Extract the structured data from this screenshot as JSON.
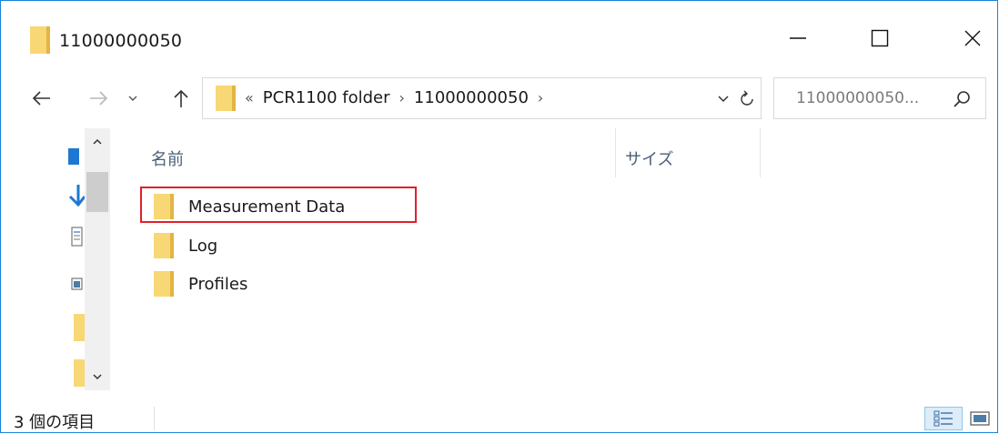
{
  "window": {
    "title": "11000000050",
    "accent": "#1883d7"
  },
  "address_bar": {
    "overflow": "«",
    "crumbs": [
      "PCR1100 folder",
      "11000000050"
    ],
    "separator": "›"
  },
  "search": {
    "placeholder": "11000000050..."
  },
  "columns": {
    "name": "名前",
    "size": "サイズ"
  },
  "files": [
    {
      "name": "Measurement Data",
      "icon": "folder-icon",
      "highlighted": true
    },
    {
      "name": "Log",
      "icon": "folder-icon",
      "highlighted": false
    },
    {
      "name": "Profiles",
      "icon": "folder-icon",
      "highlighted": false
    }
  ],
  "status": {
    "item_count": "3 個の項目"
  },
  "colors": {
    "folder": "#f8d775",
    "folder_dark": "#e3b444",
    "highlight": "#e0202a"
  }
}
